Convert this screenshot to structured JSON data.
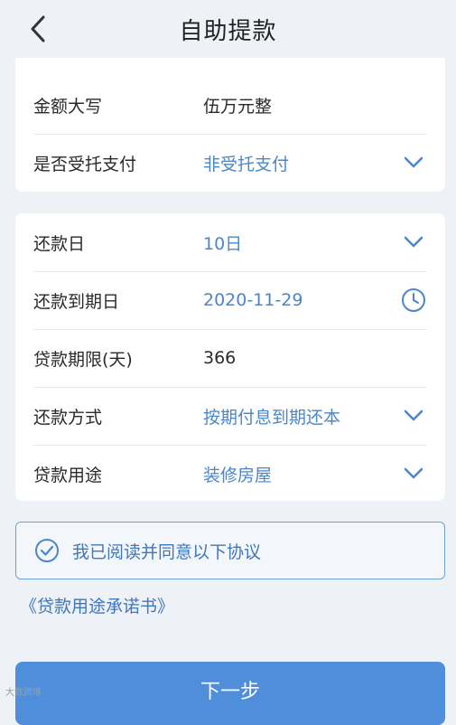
{
  "header": {
    "title": "自助提款"
  },
  "section1": {
    "rows": [
      {
        "label": "金额大写",
        "value": "伍万元整"
      },
      {
        "label": "是否受托支付",
        "value": "非受托支付"
      }
    ]
  },
  "section2": {
    "rows": [
      {
        "label": "还款日",
        "value": "10日"
      },
      {
        "label": "还款到期日",
        "value": "2020-11-29"
      },
      {
        "label": "贷款期限(天)",
        "value": "366"
      },
      {
        "label": "还款方式",
        "value": "按期付息到期还本"
      },
      {
        "label": "贷款用途",
        "value": "装修房屋"
      }
    ]
  },
  "agreement": {
    "text": "我已阅读并同意以下协议",
    "link": "《贷款用途承诺书》"
  },
  "actions": {
    "next": "下一步"
  },
  "watermark": "大数跨境",
  "colors": {
    "accent": "#4a86c9",
    "button": "#4f8edb"
  },
  "icons": {
    "back": "chevron-left-icon",
    "dropdown": "chevron-down-icon",
    "calendar": "clock-icon",
    "check": "check-circle-icon"
  }
}
